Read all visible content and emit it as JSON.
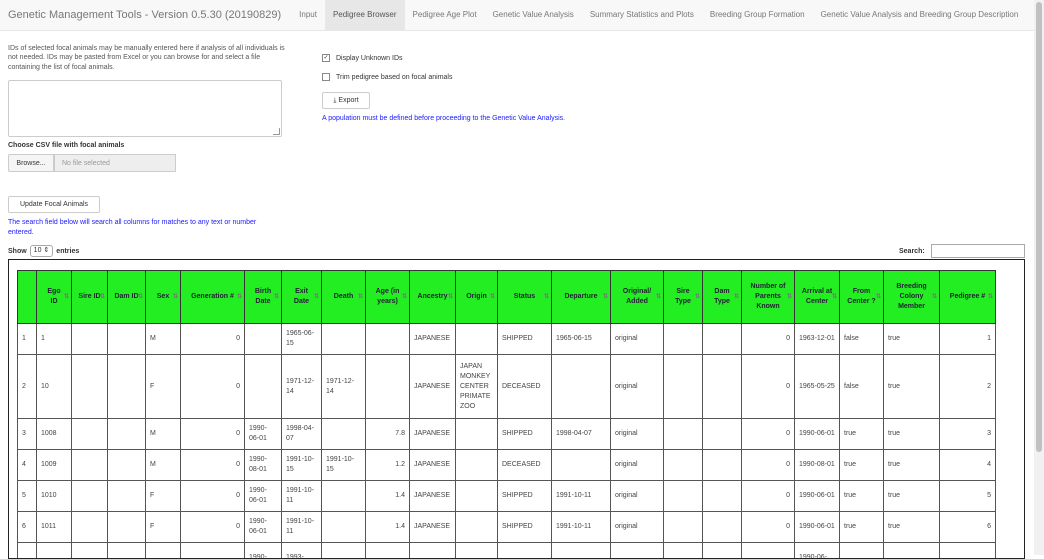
{
  "app": {
    "title": "Genetic Management Tools - Version 0.5.30 (20190829)"
  },
  "tabs": [
    {
      "label": "Input",
      "active": false
    },
    {
      "label": "Pedigree Browser",
      "active": true
    },
    {
      "label": "Pedigree Age Plot",
      "active": false
    },
    {
      "label": "Genetic Value Analysis",
      "active": false
    },
    {
      "label": "Summary Statistics and Plots",
      "active": false
    },
    {
      "label": "Breeding Group Formation",
      "active": false
    },
    {
      "label": "Genetic Value Analysis and Breeding Group Description",
      "active": false
    }
  ],
  "left": {
    "help_text": "IDs of selected focal animals may be manually entered here if analysis of all individuals is not needed. IDs may be pasted from Excel or you can browse for and select a file containing the list of focal animals.",
    "ids_value": "",
    "csv_label": "Choose CSV file with focal animals",
    "browse_label": "Browse...",
    "file_placeholder": "No file selected",
    "update_label": "Update Focal Animals",
    "search_note": "The search field below will search all columns for matches to any text or number entered."
  },
  "right": {
    "display_unknown_label": "Display Unknown IDs",
    "display_unknown_checked": true,
    "trim_label": "Trim pedigree based on focal animals",
    "trim_checked": false,
    "export_label": "Export",
    "population_note": "A population must be defined before proceeding to the Genetic Value Analysis."
  },
  "table_controls": {
    "show_label": "Show",
    "entries_value": "10",
    "entries_label": "entries",
    "search_label": "Search:",
    "search_value": ""
  },
  "colors": {
    "header_green": "#22ee22",
    "note_blue": "#1a1aff"
  },
  "table": {
    "columns": [
      "",
      "Ego ID",
      "Sire ID",
      "Dam ID",
      "Sex",
      "Generation #",
      "Birth Date",
      "Exit Date",
      "Death",
      "Age (in years)",
      "Ancestry",
      "Origin",
      "Status",
      "Departure",
      "Original/ Added",
      "Sire Type",
      "Dam Type",
      "Number of Parents Known",
      "Arrival at Center",
      "From Center ?",
      "Breeding Colony Member",
      "Pedigree #"
    ],
    "rows": [
      [
        "1",
        "1",
        "",
        "",
        "M",
        "0",
        "",
        "1965-06-15",
        "",
        "",
        "JAPANESE",
        "",
        "SHIPPED",
        "1965-06-15",
        "original",
        "",
        "",
        "0",
        "1963-12-01",
        "false",
        "true",
        "1"
      ],
      [
        "2",
        "10",
        "",
        "",
        "F",
        "0",
        "",
        "1971-12-14",
        "1971-12-14",
        "",
        "JAPANESE",
        "JAPAN MONKEY CENTER PRIMATE ZOO",
        "DECEASED",
        "",
        "original",
        "",
        "",
        "0",
        "1965-05-25",
        "false",
        "true",
        "2"
      ],
      [
        "3",
        "1008",
        "",
        "",
        "M",
        "0",
        "1990-06-01",
        "1998-04-07",
        "",
        "7.8",
        "JAPANESE",
        "",
        "SHIPPED",
        "1998-04-07",
        "original",
        "",
        "",
        "0",
        "1990-06-01",
        "true",
        "true",
        "3"
      ],
      [
        "4",
        "1009",
        "",
        "",
        "M",
        "0",
        "1990-08-01",
        "1991-10-15",
        "1991-10-15",
        "1.2",
        "JAPANESE",
        "",
        "DECEASED",
        "",
        "original",
        "",
        "",
        "0",
        "1990-08-01",
        "true",
        "true",
        "4"
      ],
      [
        "5",
        "1010",
        "",
        "",
        "F",
        "0",
        "1990-06-01",
        "1991-10-11",
        "",
        "1.4",
        "JAPANESE",
        "",
        "SHIPPED",
        "1991-10-11",
        "original",
        "",
        "",
        "0",
        "1990-06-01",
        "true",
        "true",
        "5"
      ],
      [
        "6",
        "1011",
        "",
        "",
        "F",
        "0",
        "1990-06-01",
        "1991-10-11",
        "",
        "1.4",
        "JAPANESE",
        "",
        "SHIPPED",
        "1991-10-11",
        "original",
        "",
        "",
        "0",
        "1990-06-01",
        "true",
        "true",
        "6"
      ],
      [
        "",
        "",
        "",
        "",
        "",
        "",
        "1990-",
        "1993-",
        "",
        "",
        "",
        "",
        "",
        "",
        "",
        "",
        "",
        "",
        "1990-06-",
        "",
        "",
        ""
      ]
    ]
  }
}
